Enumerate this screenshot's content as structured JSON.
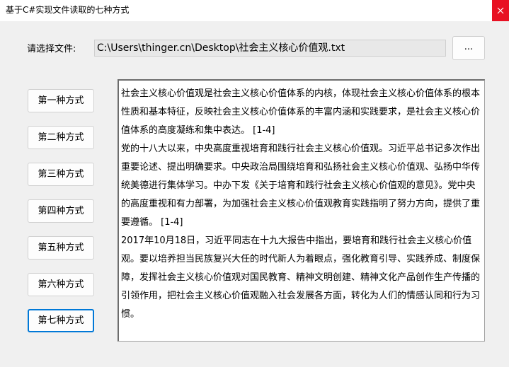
{
  "window": {
    "title": "基于C#实现文件读取的七种方式"
  },
  "file": {
    "label": "请选择文件:",
    "path": "C:\\Users\\thinger.cn\\Desktop\\社会主义核心价值观.txt",
    "browse_label": "..."
  },
  "methods": [
    {
      "label": "第一种方式"
    },
    {
      "label": "第二种方式"
    },
    {
      "label": "第三种方式"
    },
    {
      "label": "第四种方式"
    },
    {
      "label": "第五种方式"
    },
    {
      "label": "第六种方式"
    },
    {
      "label": "第七种方式"
    }
  ],
  "content": {
    "paragraphs": [
      "社会主义核心价值观是社会主义核心价值体系的内核，体现社会主义核心价值体系的根本性质和基本特征，反映社会主义核心价值体系的丰富内涵和实践要求，是社会主义核心价值体系的高度凝练和集中表达。 [1-4]",
      "党的十八大以来，中央高度重视培育和践行社会主义核心价值观。习近平总书记多次作出重要论述、提出明确要求。中央政治局围绕培育和弘扬社会主义核心价值观、弘扬中华传统美德进行集体学习。中办下发《关于培育和践行社会主义核心价值观的意见》。党中央的高度重视和有力部署，为加强社会主义核心价值观教育实践指明了努力方向，提供了重要遵循。 [1-4]",
      "2017年10月18日，习近平同志在十九大报告中指出，要培育和践行社会主义核心价值观。要以培养担当民族复兴大任的时代新人为着眼点，强化教育引导、实践养成、制度保障，发挥社会主义核心价值观对国民教育、精神文明创建、精神文化产品创作生产传播的引领作用，把社会主义核心价值观融入社会发展各方面，转化为人们的情感认同和行为习惯。"
    ]
  }
}
